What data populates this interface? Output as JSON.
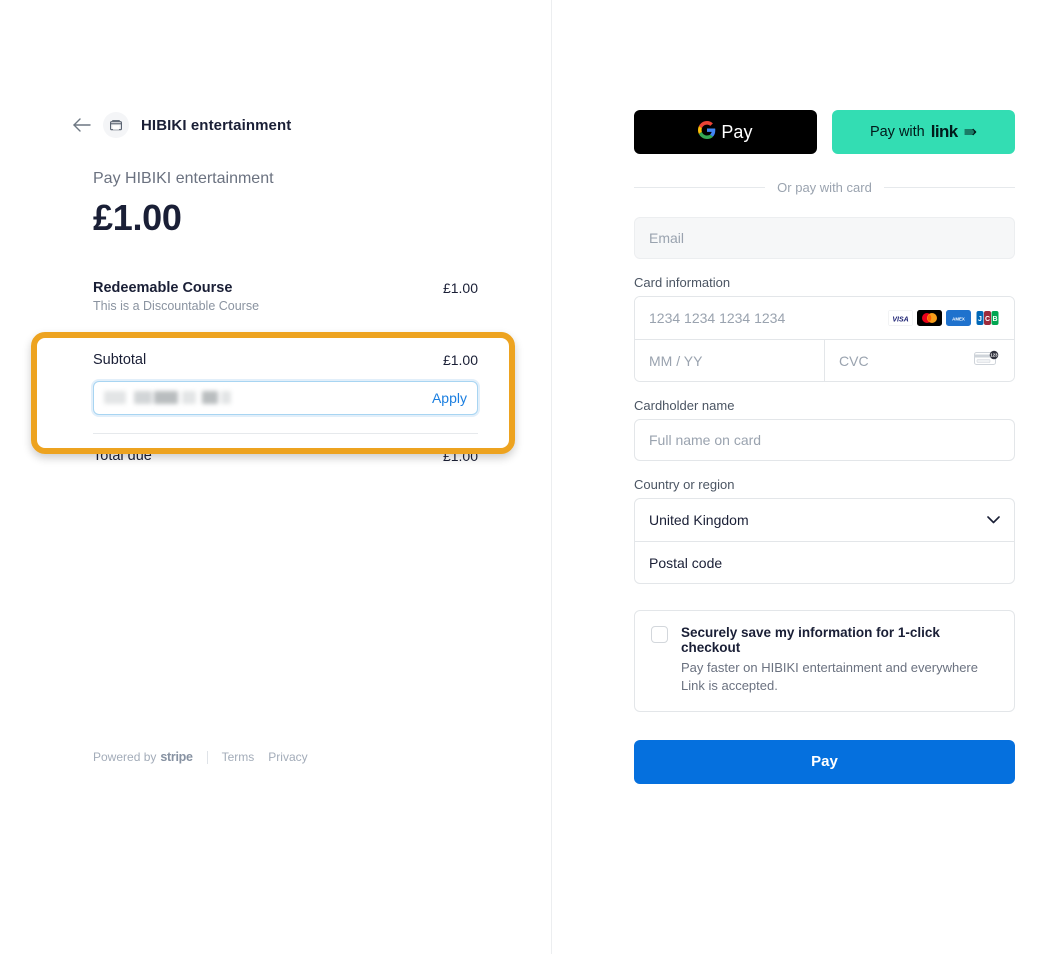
{
  "left": {
    "back_icon": "arrow-left-icon",
    "merchant_avatar_icon": "storefront-icon",
    "merchant_name": "HIBIKI entertainment",
    "pay_label": "Pay HIBIKI entertainment",
    "amount": "£1.00",
    "line_items": [
      {
        "name": "Redeemable Course",
        "description": "This is a Discountable Course",
        "price": "£1.00"
      }
    ],
    "subtotal": {
      "label": "Subtotal",
      "value": "£1.00"
    },
    "promo": {
      "value_redacted": "████ █████",
      "apply_label": "Apply"
    },
    "total": {
      "label": "Total due",
      "value": "£1.00"
    },
    "footer": {
      "powered_by": "Powered by",
      "stripe": "stripe",
      "terms": "Terms",
      "privacy": "Privacy"
    },
    "highlight_color": "#eda320"
  },
  "right": {
    "wallets": {
      "gpay_label": "Pay",
      "gpay_icon": "google-g-icon",
      "link_prefix": "Pay with",
      "link_word": "link",
      "link_arrow": "⇛"
    },
    "divider_text": "Or pay with card",
    "email": {
      "placeholder": "Email",
      "value": ""
    },
    "card_information": {
      "label": "Card information",
      "number_placeholder": "1234 1234 1234 1234",
      "expiry_placeholder": "MM / YY",
      "cvc_placeholder": "CVC",
      "brands": [
        "visa-icon",
        "mastercard-icon",
        "amex-icon",
        "jcb-icon"
      ],
      "cvc_icon": "card-back-cvc-icon"
    },
    "cardholder": {
      "label": "Cardholder name",
      "placeholder": "Full name on card"
    },
    "country": {
      "label": "Country or region",
      "selected": "United Kingdom",
      "chevron_icon": "chevron-down-icon",
      "postal_placeholder": "Postal code"
    },
    "save_info": {
      "checked": false,
      "title": "Securely save my information for 1-click checkout",
      "subtitle": "Pay faster on HIBIKI entertainment and everywhere Link is accepted."
    },
    "pay_button": "Pay",
    "accent_color": "#0570de",
    "link_color": "#33ddb3"
  }
}
